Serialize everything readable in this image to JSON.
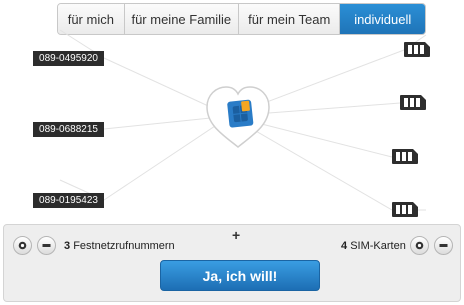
{
  "tabs": [
    {
      "label": "für mich",
      "active": false
    },
    {
      "label": "für meine Familie",
      "active": false
    },
    {
      "label": "für mein Team",
      "active": false
    },
    {
      "label": "individuell",
      "active": true
    }
  ],
  "landlines": [
    "089-0495920",
    "089-0688215",
    "089-0195423"
  ],
  "center_icon": "heart-sim-icon",
  "sim_cards": [
    "sim-card-icon",
    "sim-card-icon",
    "sim-card-icon",
    "sim-card-icon"
  ],
  "controls": {
    "landline_count": "3",
    "landline_label": "Festnetzrufnummern",
    "plus_separator": "+",
    "sim_count": "4",
    "sim_label": "SIM-Karten",
    "add_icon": "plus-circle-icon",
    "remove_icon": "minus-circle-icon"
  },
  "cta": {
    "label": "Ja, ich will!"
  },
  "colors": {
    "accent": "#1f74b8",
    "label_bg": "#2c2c2c",
    "panel_bg": "#eeeeee"
  }
}
